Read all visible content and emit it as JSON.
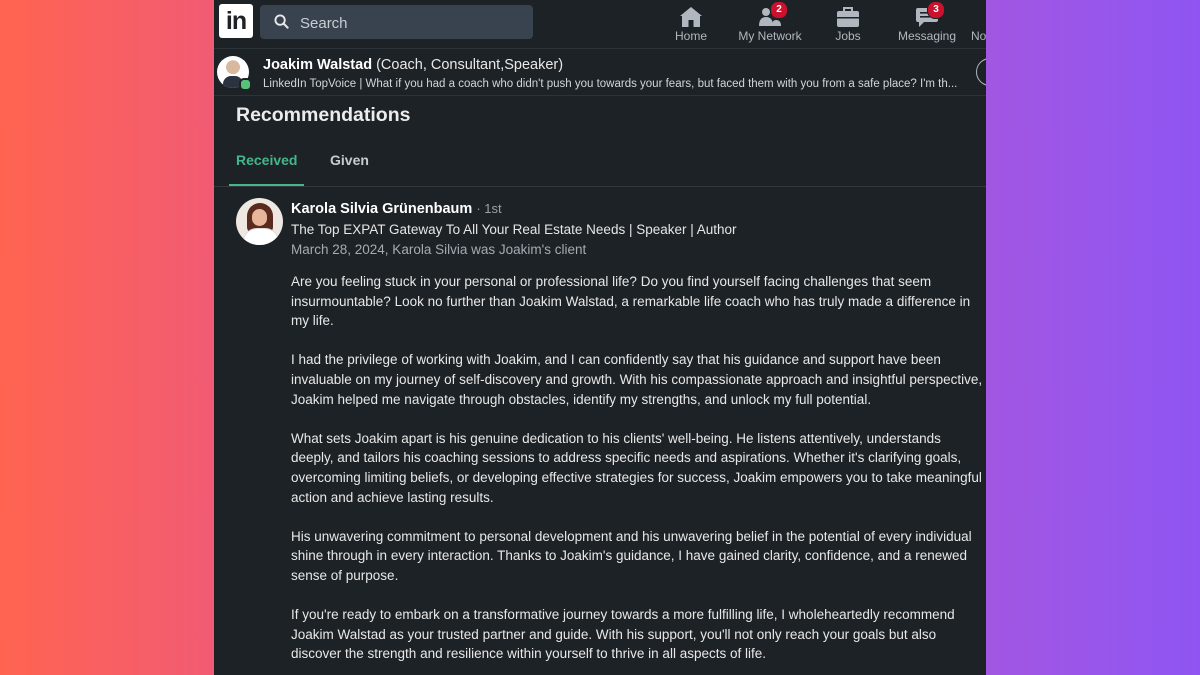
{
  "nav": {
    "logo": "in",
    "search_placeholder": "Search",
    "items": [
      {
        "label": "Home",
        "icon": "home-icon",
        "badge": null
      },
      {
        "label": "My Network",
        "icon": "network-icon",
        "badge": "2"
      },
      {
        "label": "Jobs",
        "icon": "briefcase-icon",
        "badge": null
      },
      {
        "label": "Messaging",
        "icon": "messaging-icon",
        "badge": "3"
      },
      {
        "label": "No",
        "icon": "notifications-icon",
        "badge": null
      }
    ]
  },
  "profile_bar": {
    "name": "Joakim Walstad",
    "roles": "(Coach, Consultant,Speaker)",
    "headline": "LinkedIn TopVoice | What if you had a coach who didn't push you towards your fears, but faced them with you from a safe place? I'm th..."
  },
  "recommendations": {
    "title": "Recommendations",
    "tabs": [
      {
        "label": "Received",
        "active": true
      },
      {
        "label": "Given",
        "active": false
      }
    ],
    "items": [
      {
        "name": "Karola Silvia Grünenbaum",
        "degree": "· 1st",
        "headline": "The Top EXPAT Gateway To All Your Real Estate Needs | Speaker | Author",
        "meta": "March 28, 2024, Karola Silvia was Joakim's client",
        "paragraphs": [
          "Are you feeling stuck in your personal or professional life? Do you find yourself facing challenges that seem insurmountable? Look no further than Joakim Walstad, a remarkable life coach who has truly made a difference in my life.",
          "I had the privilege of working with Joakim, and I can confidently say that his guidance and support have been invaluable on my journey of self-discovery and growth. With his compassionate approach and insightful perspective, Joakim helped me navigate through obstacles, identify my strengths, and unlock my full potential.",
          "What sets Joakim apart is his genuine dedication to his clients' well-being. He listens attentively, understands deeply, and tailors his coaching sessions to address specific needs and aspirations. Whether it's clarifying goals, overcoming limiting beliefs, or developing effective strategies for success, Joakim empowers you to take meaningful action and achieve lasting results.",
          "His unwavering commitment to personal development and his unwavering belief in the potential of every individual shine through in every interaction. Thanks to Joakim's guidance, I have gained clarity, confidence, and a renewed sense of purpose.",
          "If you're ready to embark on a transformative journey towards a more fulfilling life, I wholeheartedly recommend Joakim Walstad as your trusted partner and guide. With his support, you'll not only reach your goals but also discover the strength and resilience within yourself to thrive in all aspects of life."
        ]
      }
    ]
  },
  "colors": {
    "panel_bg": "#1d2226",
    "accent_green": "#44b68a",
    "badge_red": "#cb112d",
    "online_green": "#57c27a"
  }
}
